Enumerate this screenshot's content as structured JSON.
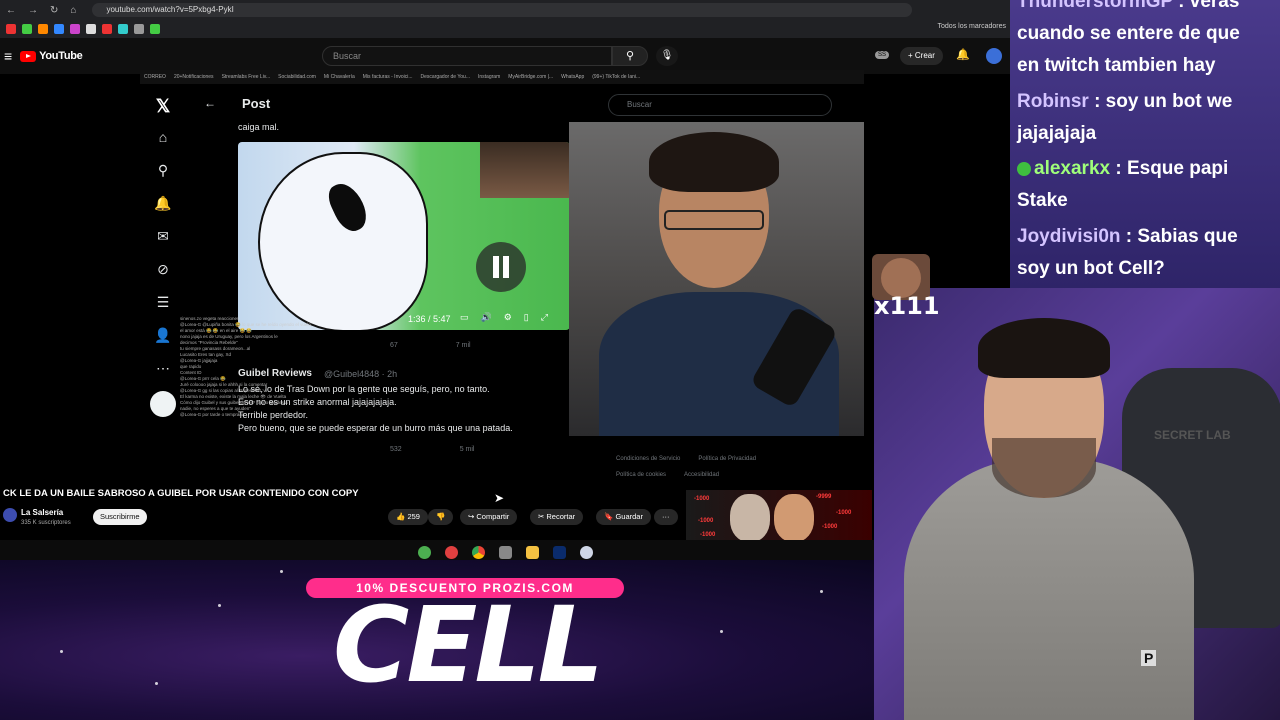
{
  "browser": {
    "url": "youtube.com/watch?v=5Pxbg4-PykI",
    "bookmarks_all": "Todos los marcadores"
  },
  "youtube": {
    "logo_text": "YouTube",
    "search_placeholder": "Buscar",
    "ss_badge": "SS",
    "create_label": "+ Crear"
  },
  "inner_bookmarks": [
    "CORREO",
    "20+Notificaciones",
    "Streamlabs Free Liv...",
    "Sociabilidad.com",
    "Mi Chavalería",
    "Mis facturas - Invoici...",
    "Descargador de You...",
    "Instagram",
    "MyAirBridge.com |...",
    "WhatsApp",
    "(99+) TikTok de Iani..."
  ],
  "x_post": {
    "title": "Post",
    "search_placeholder": "Buscar",
    "tweet_text": "caiga mal.",
    "video_time": "1:36 / 5:47",
    "stats": [
      "67",
      "7 mil"
    ],
    "reply": {
      "name": "Guibel Reviews",
      "handle": "@Guibel4848 · 2h",
      "lines": [
        "Lo sé, lo de Tras Down por la gente que seguís, pero, no tanto.",
        "Eso no es un strike anormal jajajajajaja.",
        "Terrible perdedor.",
        "Pero bueno, que se puede esperar de un burro más que una patada."
      ],
      "stats": [
        "532",
        "5 mil"
      ]
    },
    "notif_count": "14",
    "footer_links": [
      "Condiciones de Servicio",
      "Política de Privacidad"
    ],
    "footer_links2": [
      "Política de cookies",
      "Accesibilidad"
    ]
  },
  "overlay_chat": [
    "sinenos.zo vegeta reacciones",
    "@Lorea-G @Lupiña bonita 😂 lo que se he reído oyendo el vuelo,",
    "el amor está 😂 😂 en el aire 😂 😂",
    "nono jajaja es de Uruguay, pero los Argentinos le",
    "decimos \"Provincia Rebelde\"",
    "tu siempre ganasass dorameon...al",
    "Lucasito Eres tan gay, Xd",
    "@Lorea-G jajjajaja",
    "que rapido",
    "Content ID",
    "@Lorea-G prrr cela 😂",
    "Juré coloooo jajaja si le ahhh si la comentar",
    "@Lorea-G gg si las copias al Papershett :v",
    "El karma no existe, existe la mala leche 👁 de Vuelta",
    "Cómo dijo Guibel y sus guibelsinnos? \"Si no ayudes a",
    "nadie, no esperes a que te ayuden\"",
    "@Lorea-G por tarde o temprano"
  ],
  "video_info": {
    "title": "CK LE DA UN BAILE SABROSO A GUIBEL POR USAR CONTENIDO CON COPY",
    "channel": "La Salsería",
    "subscribers": "335 K suscriptores",
    "subscribe_label": "Suscribirme",
    "likes": "259",
    "share_label": "Compartir",
    "clip_label": "Recortar",
    "save_label": "Guardar",
    "more_label": "···"
  },
  "meme_numbers": [
    "-1000",
    "-9999",
    "-1000",
    "-1000",
    "-1000",
    "-1000"
  ],
  "promo": {
    "discount": "10% DESCUENTO PROZIS.COM",
    "code": "CELL"
  },
  "stream_chat": [
    {
      "user": "ThunderstormGP",
      "text": ": veras"
    },
    {
      "user": "",
      "text": "cuando se entere de que"
    },
    {
      "user": "",
      "text": "en twitch tambien hay"
    },
    {
      "user": "Robinsr",
      "text": ": soy un bot we"
    },
    {
      "user": "",
      "text": "jajajajaja"
    },
    {
      "user": "alexarkx",
      "text": ": Esque papi"
    },
    {
      "user": "",
      "text": "Stake"
    },
    {
      "user": "Joydivisi0n",
      "text": ": Sabias que"
    },
    {
      "user": "",
      "text": "soy un bot Cell?"
    }
  ],
  "emote": {
    "count": "x111"
  },
  "streamer_badge": "P",
  "chair_brand": "SECRET LAB",
  "colors": {
    "youtube_red": "#ff0000",
    "promo_pink": "#ff2d8b",
    "chat_bg": "#3d2f7a",
    "user_green": "#9fff7a"
  }
}
